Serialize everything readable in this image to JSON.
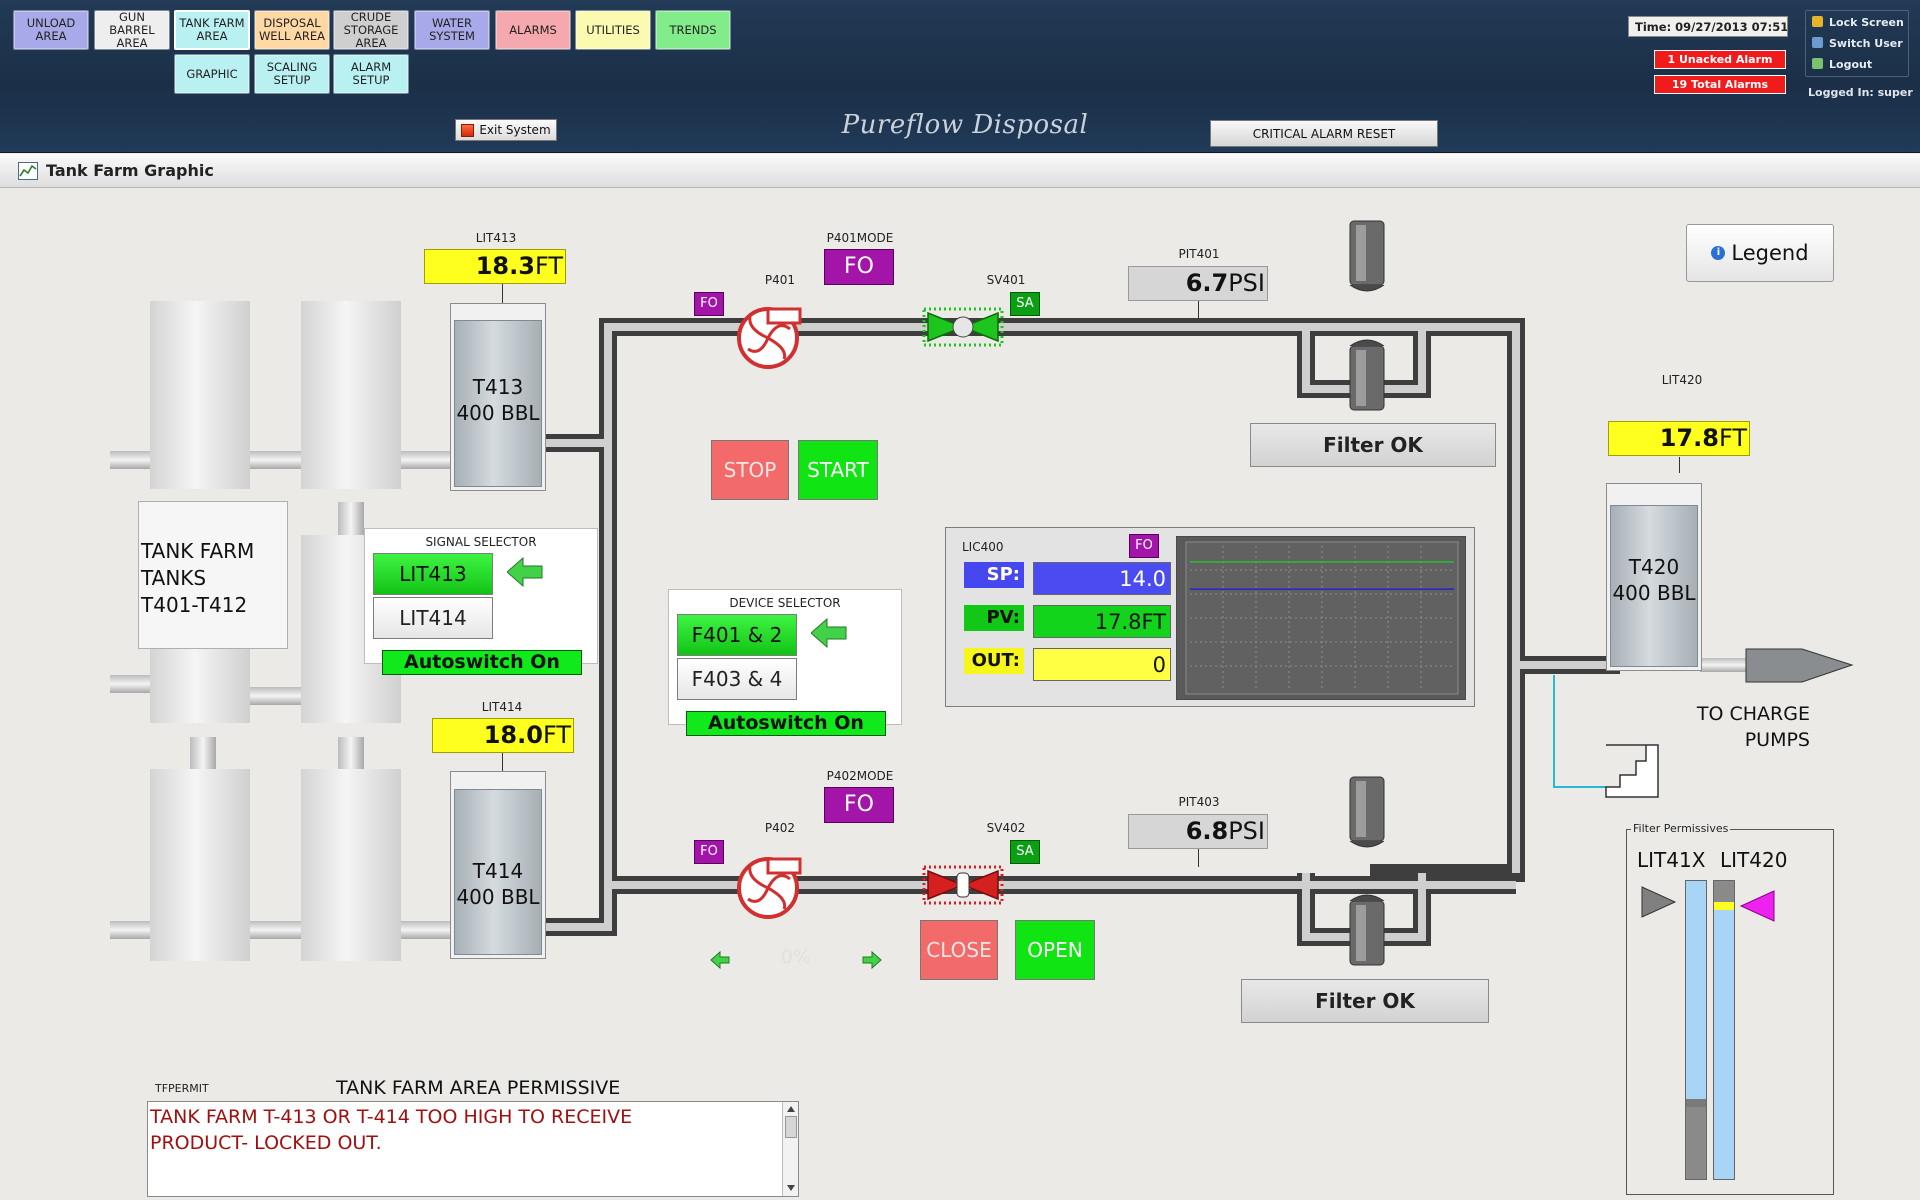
{
  "nav": {
    "row1": [
      {
        "label": "UNLOAD\nAREA",
        "color": "#a8a9e9"
      },
      {
        "label": "GUN\nBARREL\nAREA",
        "color": "#eeeeee"
      },
      {
        "label": "TANK FARM\nAREA",
        "color": "#b9f1f2",
        "selected": true
      },
      {
        "label": "DISPOSAL\nWELL AREA",
        "color": "#ffd8a4"
      },
      {
        "label": "CRUDE\nSTORAGE\nAREA",
        "color": "#cfcfcf"
      },
      {
        "label": "WATER\nSYSTEM",
        "color": "#a8a9e9"
      },
      {
        "label": "ALARMS",
        "color": "#f5a8ad"
      },
      {
        "label": "UTILITIES",
        "color": "#fafab0"
      },
      {
        "label": "TRENDS",
        "color": "#82ec8a"
      }
    ],
    "row2": [
      {
        "label": "GRAPHIC",
        "color": "#b9f1f2"
      },
      {
        "label": "SCALING\nSETUP",
        "color": "#b9f1f2"
      },
      {
        "label": "ALARM\nSETUP",
        "color": "#b9f1f2"
      }
    ]
  },
  "header": {
    "time": "Time: 09/27/2013 07:51 ...",
    "unacked_alarms": "1 Unacked Alarm",
    "total_alarms": "19 Total Alarms",
    "lock_screen": "Lock Screen",
    "switch_user": "Switch User",
    "logout": "Logout",
    "logged_in": "Logged In: super",
    "exit_system": "Exit System",
    "brand": "Pureflow Disposal",
    "critical_alarm_reset": "CRITICAL ALARM RESET"
  },
  "page": {
    "title": "Tank Farm Graphic"
  },
  "tanks": {
    "farm_label": "TANK FARM\nTANKS\nT401-T412",
    "t413": {
      "name": "T413",
      "capacity": "400 BBL",
      "tag": "LIT413",
      "value": "18.3",
      "unit": "FT",
      "level": 0.93
    },
    "t414": {
      "name": "T414",
      "capacity": "400 BBL",
      "tag": "LIT414",
      "value": "18.0",
      "unit": "FT",
      "level": 0.92
    },
    "t420": {
      "name": "T420",
      "capacity": "400 BBL",
      "tag": "LIT420",
      "value": "17.8",
      "unit": "FT",
      "level": 0.9
    }
  },
  "signal_selector": {
    "title": "SIGNAL SELECTOR",
    "opt1": "LIT413",
    "opt2": "LIT414",
    "status": "Autoswitch On"
  },
  "device_selector": {
    "title": "DEVICE SELECTOR",
    "opt1": "F401 & 2",
    "opt2": "F403 & 4",
    "status": "Autoswitch On"
  },
  "pumps": {
    "p401": {
      "tag": "P401",
      "mode_tag": "P401MODE",
      "mode": "FO",
      "fo": "FO"
    },
    "p402": {
      "tag": "P402",
      "mode_tag": "P402MODE",
      "mode": "FO",
      "fo": "FO"
    }
  },
  "valves": {
    "sv401": {
      "tag": "SV401",
      "sa": "SA",
      "state_color": "#1ec51e"
    },
    "sv402": {
      "tag": "SV402",
      "sa": "SA",
      "state_color": "#d42020"
    }
  },
  "pressure": {
    "pit401": {
      "tag": "PIT401",
      "value": "6.7",
      "unit": "PSI"
    },
    "pit403": {
      "tag": "PIT403",
      "value": "6.8",
      "unit": "PSI"
    }
  },
  "controls": {
    "stop": "STOP",
    "start": "START",
    "close": "CLOSE",
    "open": "OPEN",
    "percent": "0%"
  },
  "filters": {
    "top": "Filter OK",
    "bottom": "Filter OK"
  },
  "lic400": {
    "tag": "LIC400",
    "fo": "FO",
    "sp_label": "SP:",
    "sp_value": "14.0",
    "pv_label": "PV:",
    "pv_value": "17.8FT",
    "out_label": "OUT:",
    "out_value": "0",
    "trend_sp": 14.0,
    "trend_pv": 17.8
  },
  "legend": {
    "label": "Legend",
    "icon": "info-icon"
  },
  "discharge": {
    "label": "TO CHARGE\nPUMPS"
  },
  "permissive": {
    "tag": "TFPERMIT",
    "title": "TANK FARM AREA PERMISSIVE",
    "message": "TANK FARM T-413 OR T-414 TOO HIGH TO RECEIVE\nPRODUCT- LOCKED OUT."
  },
  "filter_permissives": {
    "title": "Filter Permissives",
    "col1": "LIT41X",
    "col2": "LIT420",
    "col1_level": 0.24,
    "col2_level": 0.93
  }
}
